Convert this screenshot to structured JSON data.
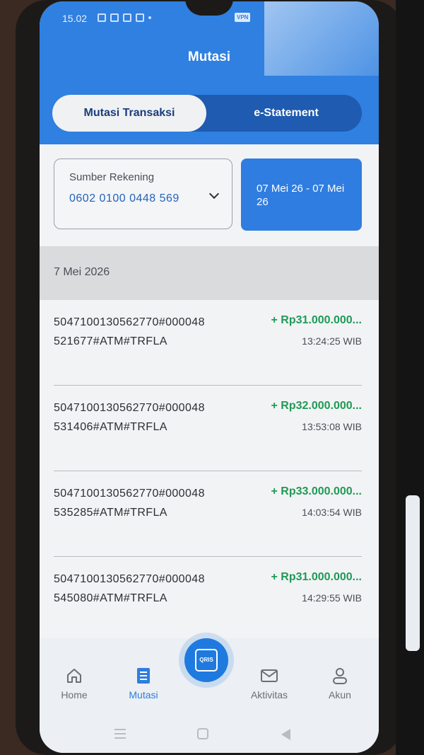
{
  "status_bar": {
    "time": "15.02",
    "vpn": "VPN"
  },
  "header": {
    "title": "Mutasi"
  },
  "tabs": [
    {
      "label": "Mutasi Transaksi",
      "active": true
    },
    {
      "label": "e-Statement",
      "active": false
    }
  ],
  "account": {
    "label": "Sumber Rekening",
    "number": "0602 0100 0448 569"
  },
  "date_range": {
    "label": "07 Mei 26 - 07 Mei 26"
  },
  "section": {
    "date": "7 Mei 2026"
  },
  "transactions": [
    {
      "description": "5047100130562770#000048521677#ATM#TRFLA",
      "amount": "+ Rp31.000.000...",
      "time": "13:24:25 WIB"
    },
    {
      "description": "5047100130562770#000048531406#ATM#TRFLA",
      "amount": "+ Rp32.000.000...",
      "time": "13:53:08 WIB"
    },
    {
      "description": "5047100130562770#000048535285#ATM#TRFLA",
      "amount": "+ Rp33.000.000...",
      "time": "14:03:54 WIB"
    },
    {
      "description": "5047100130562770#000048545080#ATM#TRFLA",
      "amount": "+ Rp31.000.000...",
      "time": "14:29:55 WIB"
    }
  ],
  "bottom_nav": {
    "items": [
      {
        "label": "Home",
        "icon": "home-icon"
      },
      {
        "label": "Mutasi",
        "icon": "list-icon",
        "active": true
      },
      {
        "label": "Aktivitas",
        "icon": "mail-icon"
      },
      {
        "label": "Akun",
        "icon": "user-icon"
      }
    ],
    "qris_label": "QRIS"
  },
  "colors": {
    "primary": "#2f80e0",
    "credit": "#1f9a55"
  }
}
